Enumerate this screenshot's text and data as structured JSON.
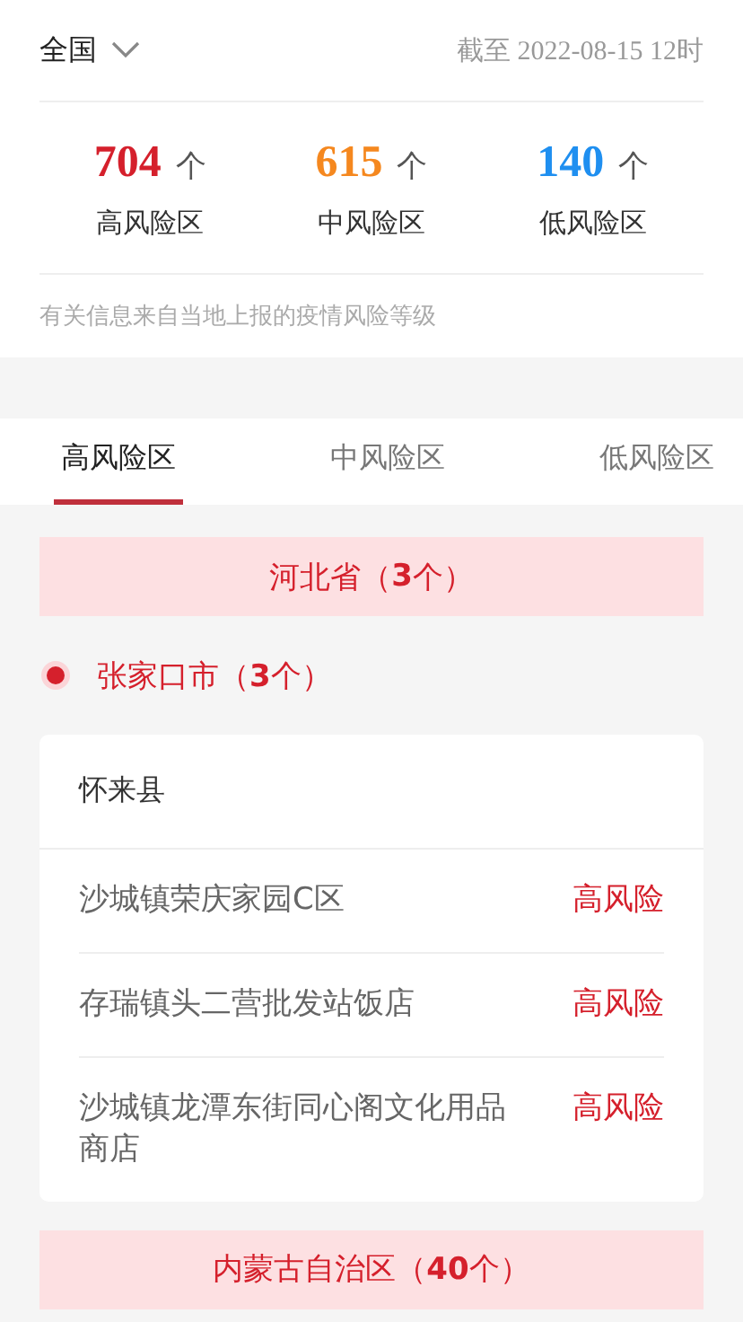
{
  "header": {
    "region": "全国",
    "updated": "截至 2022-08-15 12时"
  },
  "stats": [
    {
      "count": "704",
      "unit": "个",
      "label": "高风险区",
      "color": "#d5202c"
    },
    {
      "count": "615",
      "unit": "个",
      "label": "中风险区",
      "color": "#f5881f"
    },
    {
      "count": "140",
      "unit": "个",
      "label": "低风险区",
      "color": "#1f8ff0"
    }
  ],
  "note": "有关信息来自当地上报的疫情风险等级",
  "tabs": [
    {
      "label": "高风险区",
      "selected": true
    },
    {
      "label": "中风险区",
      "selected": false
    },
    {
      "label": "低风险区",
      "selected": false
    }
  ],
  "provinces": [
    {
      "title": "河北省（**3**个）",
      "cities": [
        {
          "title": "张家口市（**3**个）",
          "counties": [
            {
              "name": "怀来县",
              "places": [
                {
                  "name": "沙城镇荣庆家园C区",
                  "risk": "高风险"
                },
                {
                  "name": "存瑞镇头二营批发站饭店",
                  "risk": "高风险"
                },
                {
                  "name": "沙城镇龙潭东街同心阁文化用品商店",
                  "risk": "高风险"
                }
              ]
            }
          ]
        }
      ]
    },
    {
      "title": "内蒙古自治区（**40**个）"
    }
  ]
}
